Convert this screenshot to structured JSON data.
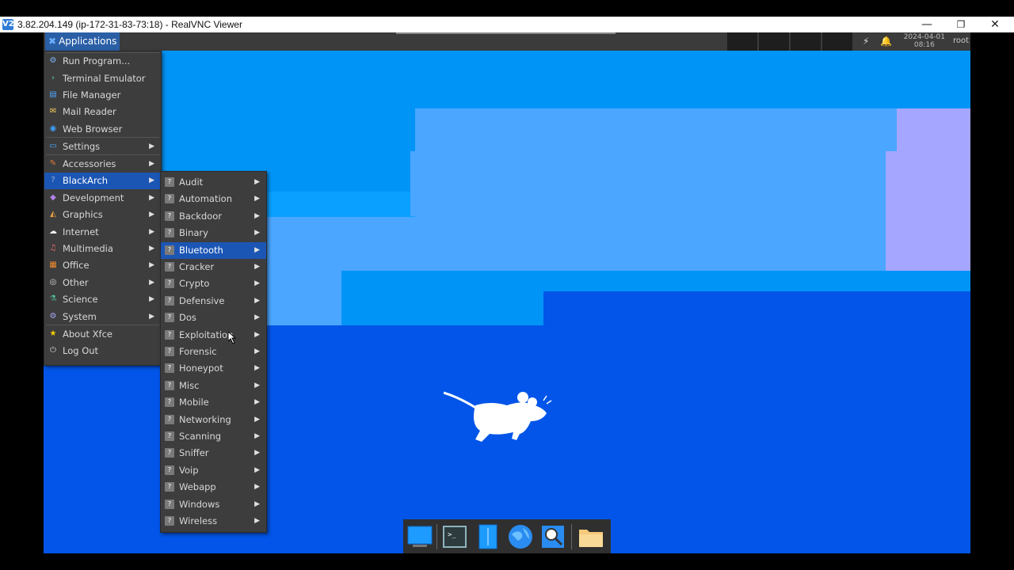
{
  "window": {
    "title": "3.82.204.149 (ip-172-31-83-73:18) - RealVNC Viewer",
    "app_icon": "V2",
    "controls": {
      "minimize": "—",
      "restore": "❐",
      "close": "✕"
    }
  },
  "panel": {
    "applications_label": "Applications",
    "clock_date": "2024-04-01",
    "clock_time": "08:16",
    "user": "root"
  },
  "main_menu": {
    "items": [
      {
        "label": "Run Program...",
        "icon": "run-icon",
        "submenu": false
      },
      {
        "label": "Terminal Emulator",
        "icon": "terminal-icon",
        "submenu": false
      },
      {
        "label": "File Manager",
        "icon": "file-manager-icon",
        "submenu": false
      },
      {
        "label": "Mail Reader",
        "icon": "mail-icon",
        "submenu": false
      },
      {
        "label": "Web Browser",
        "icon": "globe-icon",
        "submenu": false
      },
      {
        "label": "Settings",
        "icon": "settings-icon",
        "submenu": true
      },
      {
        "label": "Accessories",
        "icon": "accessories-icon",
        "submenu": true
      },
      {
        "label": "BlackArch",
        "icon": "blackarch-icon",
        "submenu": true,
        "highlighted": true
      },
      {
        "label": "Development",
        "icon": "development-icon",
        "submenu": true
      },
      {
        "label": "Graphics",
        "icon": "graphics-icon",
        "submenu": true
      },
      {
        "label": "Internet",
        "icon": "internet-icon",
        "submenu": true
      },
      {
        "label": "Multimedia",
        "icon": "multimedia-icon",
        "submenu": true
      },
      {
        "label": "Office",
        "icon": "office-icon",
        "submenu": true
      },
      {
        "label": "Other",
        "icon": "other-icon",
        "submenu": true
      },
      {
        "label": "Science",
        "icon": "science-icon",
        "submenu": true
      },
      {
        "label": "System",
        "icon": "system-icon",
        "submenu": true
      },
      {
        "label": "About Xfce",
        "icon": "star-icon",
        "submenu": false
      },
      {
        "label": "Log Out",
        "icon": "logout-icon",
        "submenu": false
      }
    ]
  },
  "blackarch_menu": {
    "items": [
      {
        "label": "Audit"
      },
      {
        "label": "Automation"
      },
      {
        "label": "Backdoor"
      },
      {
        "label": "Binary"
      },
      {
        "label": "Bluetooth",
        "highlighted": true
      },
      {
        "label": "Cracker"
      },
      {
        "label": "Crypto"
      },
      {
        "label": "Defensive"
      },
      {
        "label": "Dos"
      },
      {
        "label": "Exploitation"
      },
      {
        "label": "Forensic"
      },
      {
        "label": "Honeypot"
      },
      {
        "label": "Misc"
      },
      {
        "label": "Mobile"
      },
      {
        "label": "Networking"
      },
      {
        "label": "Scanning"
      },
      {
        "label": "Sniffer"
      },
      {
        "label": "Voip"
      },
      {
        "label": "Webapp"
      },
      {
        "label": "Windows"
      },
      {
        "label": "Wireless"
      }
    ]
  },
  "dock": {
    "items": [
      {
        "icon": "show-desktop-icon"
      },
      {
        "icon": "terminal-icon"
      },
      {
        "icon": "file-manager-icon"
      },
      {
        "icon": "web-browser-icon"
      },
      {
        "icon": "app-finder-icon"
      },
      {
        "icon": "folder-icon"
      }
    ]
  },
  "colors": {
    "desktop_bg": "#0255e8",
    "menu_bg": "#3d3d3d",
    "highlight": "#1c56b5",
    "panel_bg": "#3b3b3b"
  }
}
